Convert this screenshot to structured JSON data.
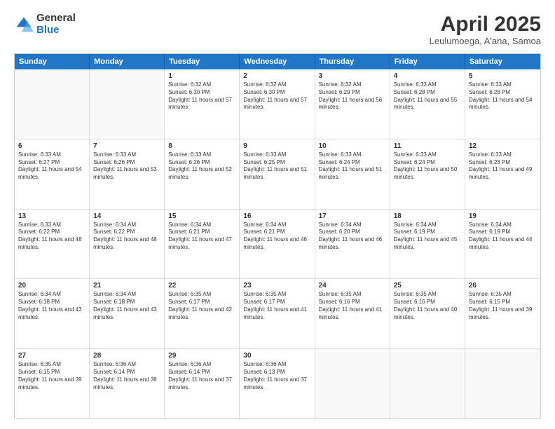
{
  "logo": {
    "general": "General",
    "blue": "Blue"
  },
  "title": "April 2025",
  "subtitle": "Leulumoega, A'ana, Samoa",
  "header_days": [
    "Sunday",
    "Monday",
    "Tuesday",
    "Wednesday",
    "Thursday",
    "Friday",
    "Saturday"
  ],
  "weeks": [
    [
      {
        "day": "",
        "sunrise": "",
        "sunset": "",
        "daylight": ""
      },
      {
        "day": "",
        "sunrise": "",
        "sunset": "",
        "daylight": ""
      },
      {
        "day": "1",
        "sunrise": "Sunrise: 6:32 AM",
        "sunset": "Sunset: 6:30 PM",
        "daylight": "Daylight: 11 hours and 57 minutes."
      },
      {
        "day": "2",
        "sunrise": "Sunrise: 6:32 AM",
        "sunset": "Sunset: 6:30 PM",
        "daylight": "Daylight: 11 hours and 57 minutes."
      },
      {
        "day": "3",
        "sunrise": "Sunrise: 6:32 AM",
        "sunset": "Sunset: 6:29 PM",
        "daylight": "Daylight: 11 hours and 56 minutes."
      },
      {
        "day": "4",
        "sunrise": "Sunrise: 6:33 AM",
        "sunset": "Sunset: 6:28 PM",
        "daylight": "Daylight: 11 hours and 55 minutes."
      },
      {
        "day": "5",
        "sunrise": "Sunrise: 6:33 AM",
        "sunset": "Sunset: 6:28 PM",
        "daylight": "Daylight: 11 hours and 54 minutes."
      }
    ],
    [
      {
        "day": "6",
        "sunrise": "Sunrise: 6:33 AM",
        "sunset": "Sunset: 6:27 PM",
        "daylight": "Daylight: 11 hours and 54 minutes."
      },
      {
        "day": "7",
        "sunrise": "Sunrise: 6:33 AM",
        "sunset": "Sunset: 6:26 PM",
        "daylight": "Daylight: 11 hours and 53 minutes."
      },
      {
        "day": "8",
        "sunrise": "Sunrise: 6:33 AM",
        "sunset": "Sunset: 6:26 PM",
        "daylight": "Daylight: 11 hours and 52 minutes."
      },
      {
        "day": "9",
        "sunrise": "Sunrise: 6:33 AM",
        "sunset": "Sunset: 6:25 PM",
        "daylight": "Daylight: 11 hours and 51 minutes."
      },
      {
        "day": "10",
        "sunrise": "Sunrise: 6:33 AM",
        "sunset": "Sunset: 6:24 PM",
        "daylight": "Daylight: 11 hours and 51 minutes."
      },
      {
        "day": "11",
        "sunrise": "Sunrise: 6:33 AM",
        "sunset": "Sunset: 6:24 PM",
        "daylight": "Daylight: 11 hours and 50 minutes."
      },
      {
        "day": "12",
        "sunrise": "Sunrise: 6:33 AM",
        "sunset": "Sunset: 6:23 PM",
        "daylight": "Daylight: 11 hours and 49 minutes."
      }
    ],
    [
      {
        "day": "13",
        "sunrise": "Sunrise: 6:33 AM",
        "sunset": "Sunset: 6:22 PM",
        "daylight": "Daylight: 11 hours and 48 minutes."
      },
      {
        "day": "14",
        "sunrise": "Sunrise: 6:34 AM",
        "sunset": "Sunset: 6:22 PM",
        "daylight": "Daylight: 11 hours and 48 minutes."
      },
      {
        "day": "15",
        "sunrise": "Sunrise: 6:34 AM",
        "sunset": "Sunset: 6:21 PM",
        "daylight": "Daylight: 11 hours and 47 minutes."
      },
      {
        "day": "16",
        "sunrise": "Sunrise: 6:34 AM",
        "sunset": "Sunset: 6:21 PM",
        "daylight": "Daylight: 11 hours and 46 minutes."
      },
      {
        "day": "17",
        "sunrise": "Sunrise: 6:34 AM",
        "sunset": "Sunset: 6:20 PM",
        "daylight": "Daylight: 11 hours and 46 minutes."
      },
      {
        "day": "18",
        "sunrise": "Sunrise: 6:34 AM",
        "sunset": "Sunset: 6:19 PM",
        "daylight": "Daylight: 11 hours and 45 minutes."
      },
      {
        "day": "19",
        "sunrise": "Sunrise: 6:34 AM",
        "sunset": "Sunset: 6:19 PM",
        "daylight": "Daylight: 11 hours and 44 minutes."
      }
    ],
    [
      {
        "day": "20",
        "sunrise": "Sunrise: 6:34 AM",
        "sunset": "Sunset: 6:18 PM",
        "daylight": "Daylight: 11 hours and 43 minutes."
      },
      {
        "day": "21",
        "sunrise": "Sunrise: 6:34 AM",
        "sunset": "Sunset: 6:18 PM",
        "daylight": "Daylight: 11 hours and 43 minutes."
      },
      {
        "day": "22",
        "sunrise": "Sunrise: 6:35 AM",
        "sunset": "Sunset: 6:17 PM",
        "daylight": "Daylight: 11 hours and 42 minutes."
      },
      {
        "day": "23",
        "sunrise": "Sunrise: 6:35 AM",
        "sunset": "Sunset: 6:17 PM",
        "daylight": "Daylight: 11 hours and 41 minutes."
      },
      {
        "day": "24",
        "sunrise": "Sunrise: 6:35 AM",
        "sunset": "Sunset: 6:16 PM",
        "daylight": "Daylight: 11 hours and 41 minutes."
      },
      {
        "day": "25",
        "sunrise": "Sunrise: 6:35 AM",
        "sunset": "Sunset: 6:16 PM",
        "daylight": "Daylight: 11 hours and 40 minutes."
      },
      {
        "day": "26",
        "sunrise": "Sunrise: 6:35 AM",
        "sunset": "Sunset: 6:15 PM",
        "daylight": "Daylight: 11 hours and 39 minutes."
      }
    ],
    [
      {
        "day": "27",
        "sunrise": "Sunrise: 6:35 AM",
        "sunset": "Sunset: 6:15 PM",
        "daylight": "Daylight: 11 hours and 39 minutes."
      },
      {
        "day": "28",
        "sunrise": "Sunrise: 6:36 AM",
        "sunset": "Sunset: 6:14 PM",
        "daylight": "Daylight: 11 hours and 38 minutes."
      },
      {
        "day": "29",
        "sunrise": "Sunrise: 6:36 AM",
        "sunset": "Sunset: 6:14 PM",
        "daylight": "Daylight: 11 hours and 37 minutes."
      },
      {
        "day": "30",
        "sunrise": "Sunrise: 6:36 AM",
        "sunset": "Sunset: 6:13 PM",
        "daylight": "Daylight: 11 hours and 37 minutes."
      },
      {
        "day": "",
        "sunrise": "",
        "sunset": "",
        "daylight": ""
      },
      {
        "day": "",
        "sunrise": "",
        "sunset": "",
        "daylight": ""
      },
      {
        "day": "",
        "sunrise": "",
        "sunset": "",
        "daylight": ""
      }
    ]
  ]
}
